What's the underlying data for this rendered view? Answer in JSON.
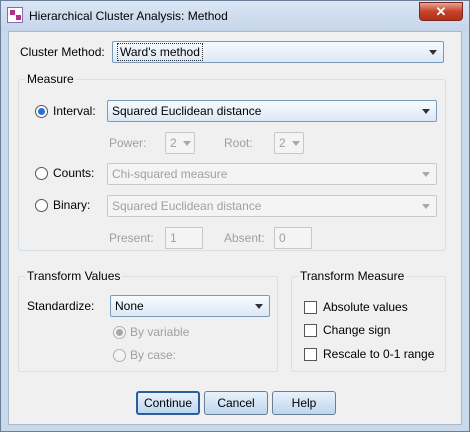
{
  "window": {
    "title": "Hierarchical Cluster Analysis: Method",
    "close_label": "✕"
  },
  "cluster_method": {
    "label": "Cluster Method:",
    "value": "Ward's method"
  },
  "measure": {
    "title": "Measure",
    "interval": {
      "label": "Interval:",
      "value": "Squared Euclidean distance",
      "selected": true,
      "power_label": "Power:",
      "power_value": "2",
      "root_label": "Root:",
      "root_value": "2"
    },
    "counts": {
      "label": "Counts:",
      "value": "Chi-squared measure",
      "selected": false
    },
    "binary": {
      "label": "Binary:",
      "value": "Squared Euclidean distance",
      "selected": false,
      "present_label": "Present:",
      "present_value": "1",
      "absent_label": "Absent:",
      "absent_value": "0"
    }
  },
  "transform_values": {
    "title": "Transform Values",
    "standardize_label": "Standardize:",
    "standardize_value": "None",
    "by_variable": "By variable",
    "by_case": "By case:"
  },
  "transform_measure": {
    "title": "Transform Measure",
    "absolute_values": "Absolute values",
    "change_sign": "Change sign",
    "rescale": "Rescale to 0-1 range"
  },
  "buttons": {
    "continue": "Continue",
    "cancel": "Cancel",
    "help": "Help"
  }
}
